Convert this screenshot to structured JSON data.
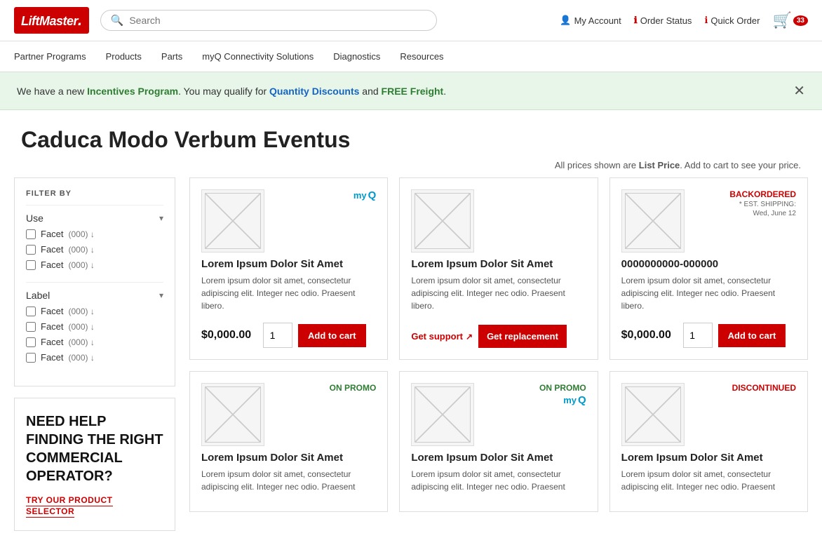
{
  "header": {
    "logo": "LiftMaster.",
    "search_placeholder": "Search",
    "my_account": "My Account",
    "order_status": "Order Status",
    "quick_order": "Quick Order",
    "cart_count": "33"
  },
  "nav": {
    "items": [
      "Partner Programs",
      "Products",
      "Parts",
      "myQ Connectivity Solutions",
      "Diagnostics",
      "Resources"
    ]
  },
  "banner": {
    "text_before": "We have a new ",
    "incentives_link": "Incentives Program",
    "text_middle": ". You may qualify for ",
    "quantity_link": "Quantity Discounts",
    "text_and": " and ",
    "free_link": "FREE Freight",
    "text_end": "."
  },
  "page_title": "Caduca Modo Verbum Eventus",
  "price_note_before": "All prices shown are ",
  "price_note_bold": "List Price",
  "price_note_after": ". Add to cart to see your price.",
  "filter": {
    "title": "FILTER BY",
    "sections": [
      {
        "label": "Use",
        "facets": [
          {
            "label": "Facet",
            "count": "(000)",
            "arrow": "↓"
          },
          {
            "label": "Facet",
            "count": "(000)",
            "arrow": "↓"
          },
          {
            "label": "Facet",
            "count": "(000)",
            "arrow": "↓"
          }
        ]
      },
      {
        "label": "Label",
        "facets": [
          {
            "label": "Facet",
            "count": "(000)",
            "arrow": "↓"
          },
          {
            "label": "Facet",
            "count": "(000)",
            "arrow": "↓"
          },
          {
            "label": "Facet",
            "count": "(000)",
            "arrow": "↓"
          },
          {
            "label": "Facet",
            "count": "(000)",
            "arrow": "↓"
          }
        ]
      }
    ]
  },
  "help_box": {
    "title": "NEED HELP FINDING THE RIGHT COMMERCIAL OPERATOR?",
    "link_text": "TRY OUR PRODUCT SELECTOR"
  },
  "products": [
    {
      "id": "p1",
      "badge_type": "myq",
      "badge_myq_text": "my",
      "badge_myq_q": "Q",
      "title": "Lorem Ipsum Dolor Sit Amet",
      "description": "Lorem ipsum dolor sit amet, consectetur adipiscing elit. Integer nec odio. Praesent libero.",
      "price": "$0,000.00",
      "qty": "1",
      "add_to_cart": "Add to cart",
      "type": "buy"
    },
    {
      "id": "p2",
      "badge_type": "none",
      "title": "Lorem Ipsum Dolor Sit Amet",
      "description": "Lorem ipsum dolor sit amet, consectetur adipiscing elit. Integer nec odio. Praesent libero.",
      "get_support": "Get support",
      "get_replacement": "Get replacement",
      "type": "support"
    },
    {
      "id": "p3",
      "badge_type": "backordered",
      "badge_text": "BACKORDERED",
      "badge_est": "* EST. SHIPPING:",
      "badge_date": "Wed, June 12",
      "title": "0000000000-000000",
      "description": "Lorem ipsum dolor sit amet, consectetur adipiscing elit. Integer nec odio. Praesent libero.",
      "price": "$0,000.00",
      "qty": "1",
      "add_to_cart": "Add to cart",
      "type": "buy"
    },
    {
      "id": "p4",
      "badge_type": "on-promo",
      "badge_text": "ON PROMO",
      "title": "Lorem Ipsum Dolor Sit Amet",
      "description": "Lorem ipsum dolor sit amet, consectetur adipiscing elit. Integer nec odio. Praesent",
      "type": "partial"
    },
    {
      "id": "p5",
      "badge_type": "on-promo-myq",
      "badge_text": "ON PROMO",
      "badge_myq_text": "my",
      "badge_myq_q": "Q",
      "title": "Lorem Ipsum Dolor Sit Amet",
      "description": "Lorem ipsum dolor sit amet, consectetur adipiscing elit. Integer nec odio. Praesent",
      "type": "partial"
    },
    {
      "id": "p6",
      "badge_type": "discontinued",
      "badge_text": "DISCONTINUED",
      "title": "Lorem Ipsum Dolor Sit Amet",
      "description": "Lorem ipsum dolor sit amet, consectetur adipiscing elit. Integer nec odio. Praesent",
      "type": "partial"
    }
  ]
}
